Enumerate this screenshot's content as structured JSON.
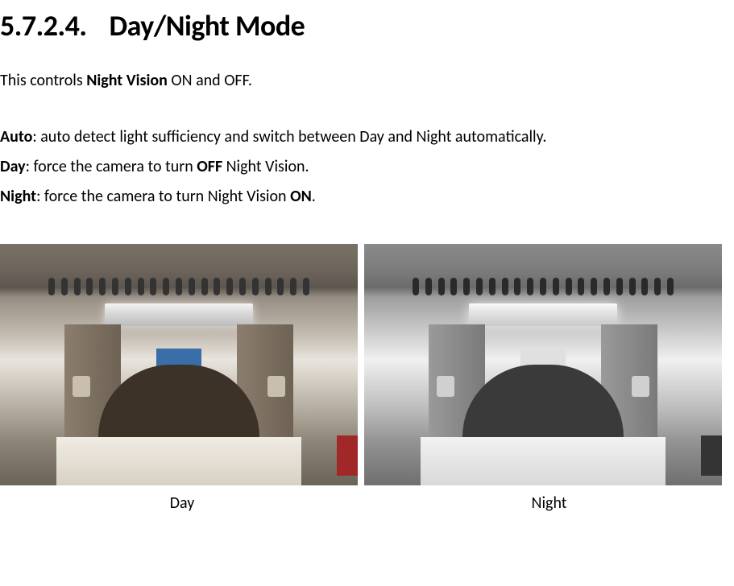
{
  "heading": {
    "number": "5.7.2.4.",
    "title": "Day/Night Mode"
  },
  "intro": {
    "prefix": "This controls ",
    "bold": "Night Vision",
    "suffix": " ON and OFF."
  },
  "modes": {
    "auto": {
      "label": "Auto",
      "text": ": auto detect light sufficiency and switch between Day and Night automatically."
    },
    "day": {
      "label": "Day",
      "text_pre": ": force the camera to turn ",
      "bold": "OFF",
      "text_post": " Night Vision."
    },
    "night": {
      "label": "Night",
      "text_pre": ": force the camera to turn Night Vision ",
      "bold": "ON",
      "text_post": "."
    }
  },
  "captions": {
    "day": "Day",
    "night": "Night"
  }
}
